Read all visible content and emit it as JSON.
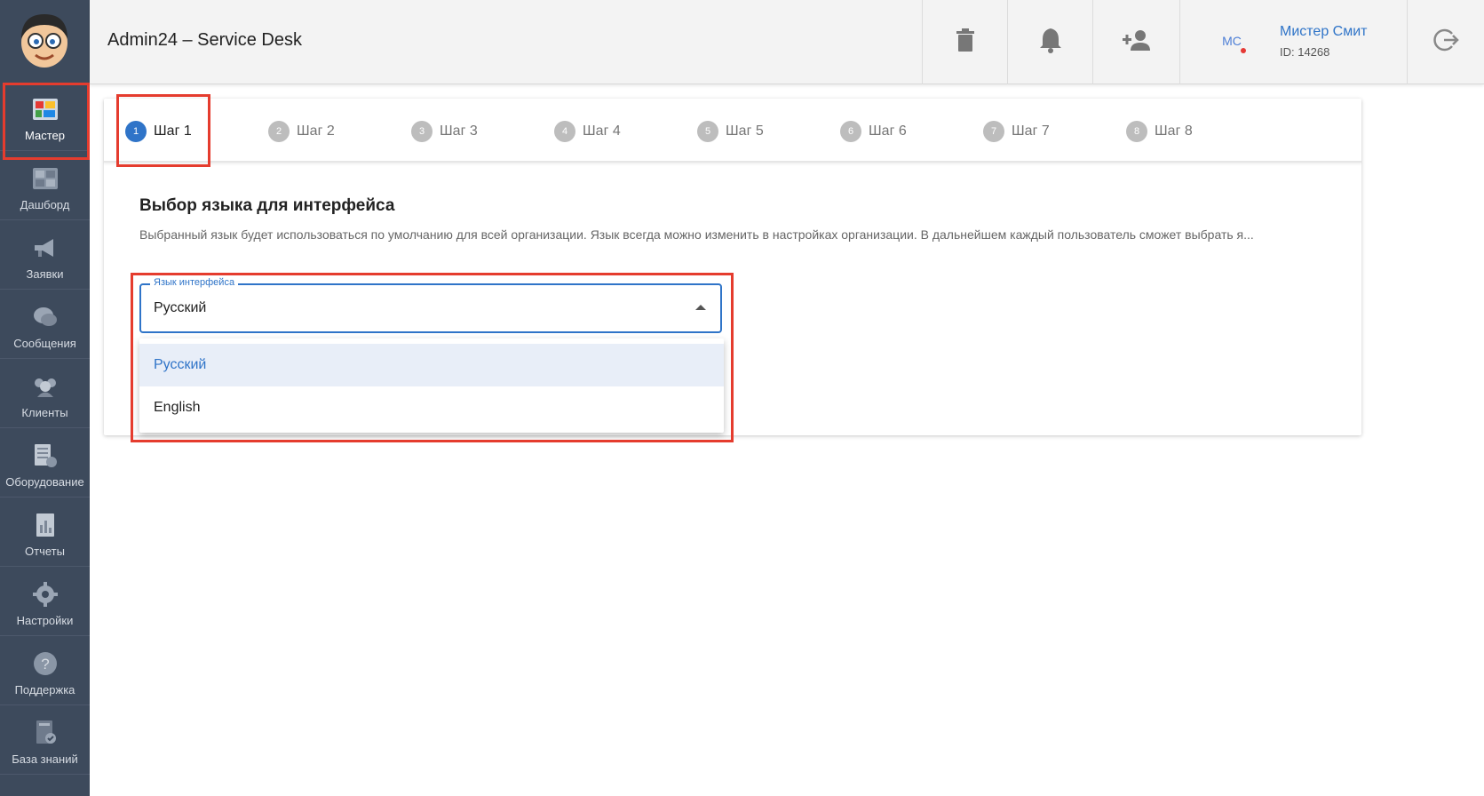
{
  "header": {
    "title": "Admin24 – Service Desk",
    "user": {
      "initials": "МС",
      "name": "Мистер Смит",
      "id": "ID: 14268"
    }
  },
  "sidebar": {
    "items": [
      {
        "label": "Мастер",
        "icon": "wizard-icon"
      },
      {
        "label": "Дашборд",
        "icon": "dashboard-icon"
      },
      {
        "label": "Заявки",
        "icon": "megaphone-icon"
      },
      {
        "label": "Сообщения",
        "icon": "chat-icon"
      },
      {
        "label": "Клиенты",
        "icon": "clients-icon"
      },
      {
        "label": "Оборудование",
        "icon": "equipment-icon"
      },
      {
        "label": "Отчеты",
        "icon": "report-icon"
      },
      {
        "label": "Настройки",
        "icon": "gear-icon"
      },
      {
        "label": "Поддержка",
        "icon": "help-icon"
      },
      {
        "label": "База знаний",
        "icon": "knowledge-base-icon"
      }
    ]
  },
  "stepper": {
    "steps": [
      {
        "num": "1",
        "label": "Шаг 1"
      },
      {
        "num": "2",
        "label": "Шаг 2"
      },
      {
        "num": "3",
        "label": "Шаг 3"
      },
      {
        "num": "4",
        "label": "Шаг 4"
      },
      {
        "num": "5",
        "label": "Шаг 5"
      },
      {
        "num": "6",
        "label": "Шаг 6"
      },
      {
        "num": "7",
        "label": "Шаг 7"
      },
      {
        "num": "8",
        "label": "Шаг 8"
      }
    ]
  },
  "content": {
    "title": "Выбор языка для интерфейса",
    "description": "Выбранный язык будет использоваться по умолчанию для всей организации. Язык всегда можно изменить в настройках организации. В дальнейшем каждый пользователь сможет выбрать я...",
    "select": {
      "label": "Язык интерфейса",
      "value": "Русский",
      "options": [
        "Русский",
        "English"
      ]
    }
  },
  "colors": {
    "accent": "#2f74c8",
    "sidebar": "#3d4a5c",
    "highlight": "#e53c2e"
  }
}
